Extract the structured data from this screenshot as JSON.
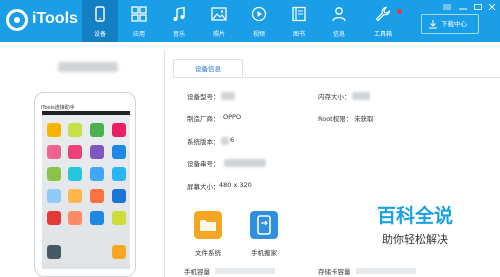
{
  "app": {
    "title": "iTools"
  },
  "nav": [
    {
      "label": "设备",
      "icon": "phone-icon",
      "active": true
    },
    {
      "label": "应用",
      "icon": "apps-grid-icon",
      "active": false
    },
    {
      "label": "音乐",
      "icon": "music-note-icon",
      "active": false
    },
    {
      "label": "照片",
      "icon": "photo-icon",
      "active": false
    },
    {
      "label": "视频",
      "icon": "video-play-icon",
      "active": false
    },
    {
      "label": "图书",
      "icon": "book-icon",
      "active": false
    },
    {
      "label": "信息",
      "icon": "person-icon",
      "active": false
    },
    {
      "label": "工具箱",
      "icon": "wrench-icon",
      "active": false
    }
  ],
  "toolbar": {
    "download_label": "下载中心"
  },
  "device": {
    "phone_title": "iTools连接助手",
    "tab_label": "设备信息",
    "fields": {
      "model_label": "设备型号：",
      "memory_label": "内存大小：",
      "manufacturer_label": "制造厂商：",
      "manufacturer_value": "OPPO",
      "root_label": "Root权限：",
      "root_value": "未获取",
      "os_label": "系统版本：",
      "os_value": "6",
      "serial_label": "设备串号：",
      "screen_label": "屏幕大小：",
      "screen_value": "480 x 320"
    },
    "actions": [
      {
        "label": "文件系统",
        "icon": "folder-icon"
      },
      {
        "label": "手机搬家",
        "icon": "phone-transfer-icon"
      }
    ],
    "storage": {
      "phone_label": "手机容量",
      "card_label": "存储卡容量"
    }
  },
  "watermark": {
    "title": "百科全说",
    "subtitle": "助你轻松解决"
  },
  "colors": {
    "accent": "#1a9ee8",
    "active_nav": "#1380c6",
    "tab_text": "#1a73c8"
  }
}
